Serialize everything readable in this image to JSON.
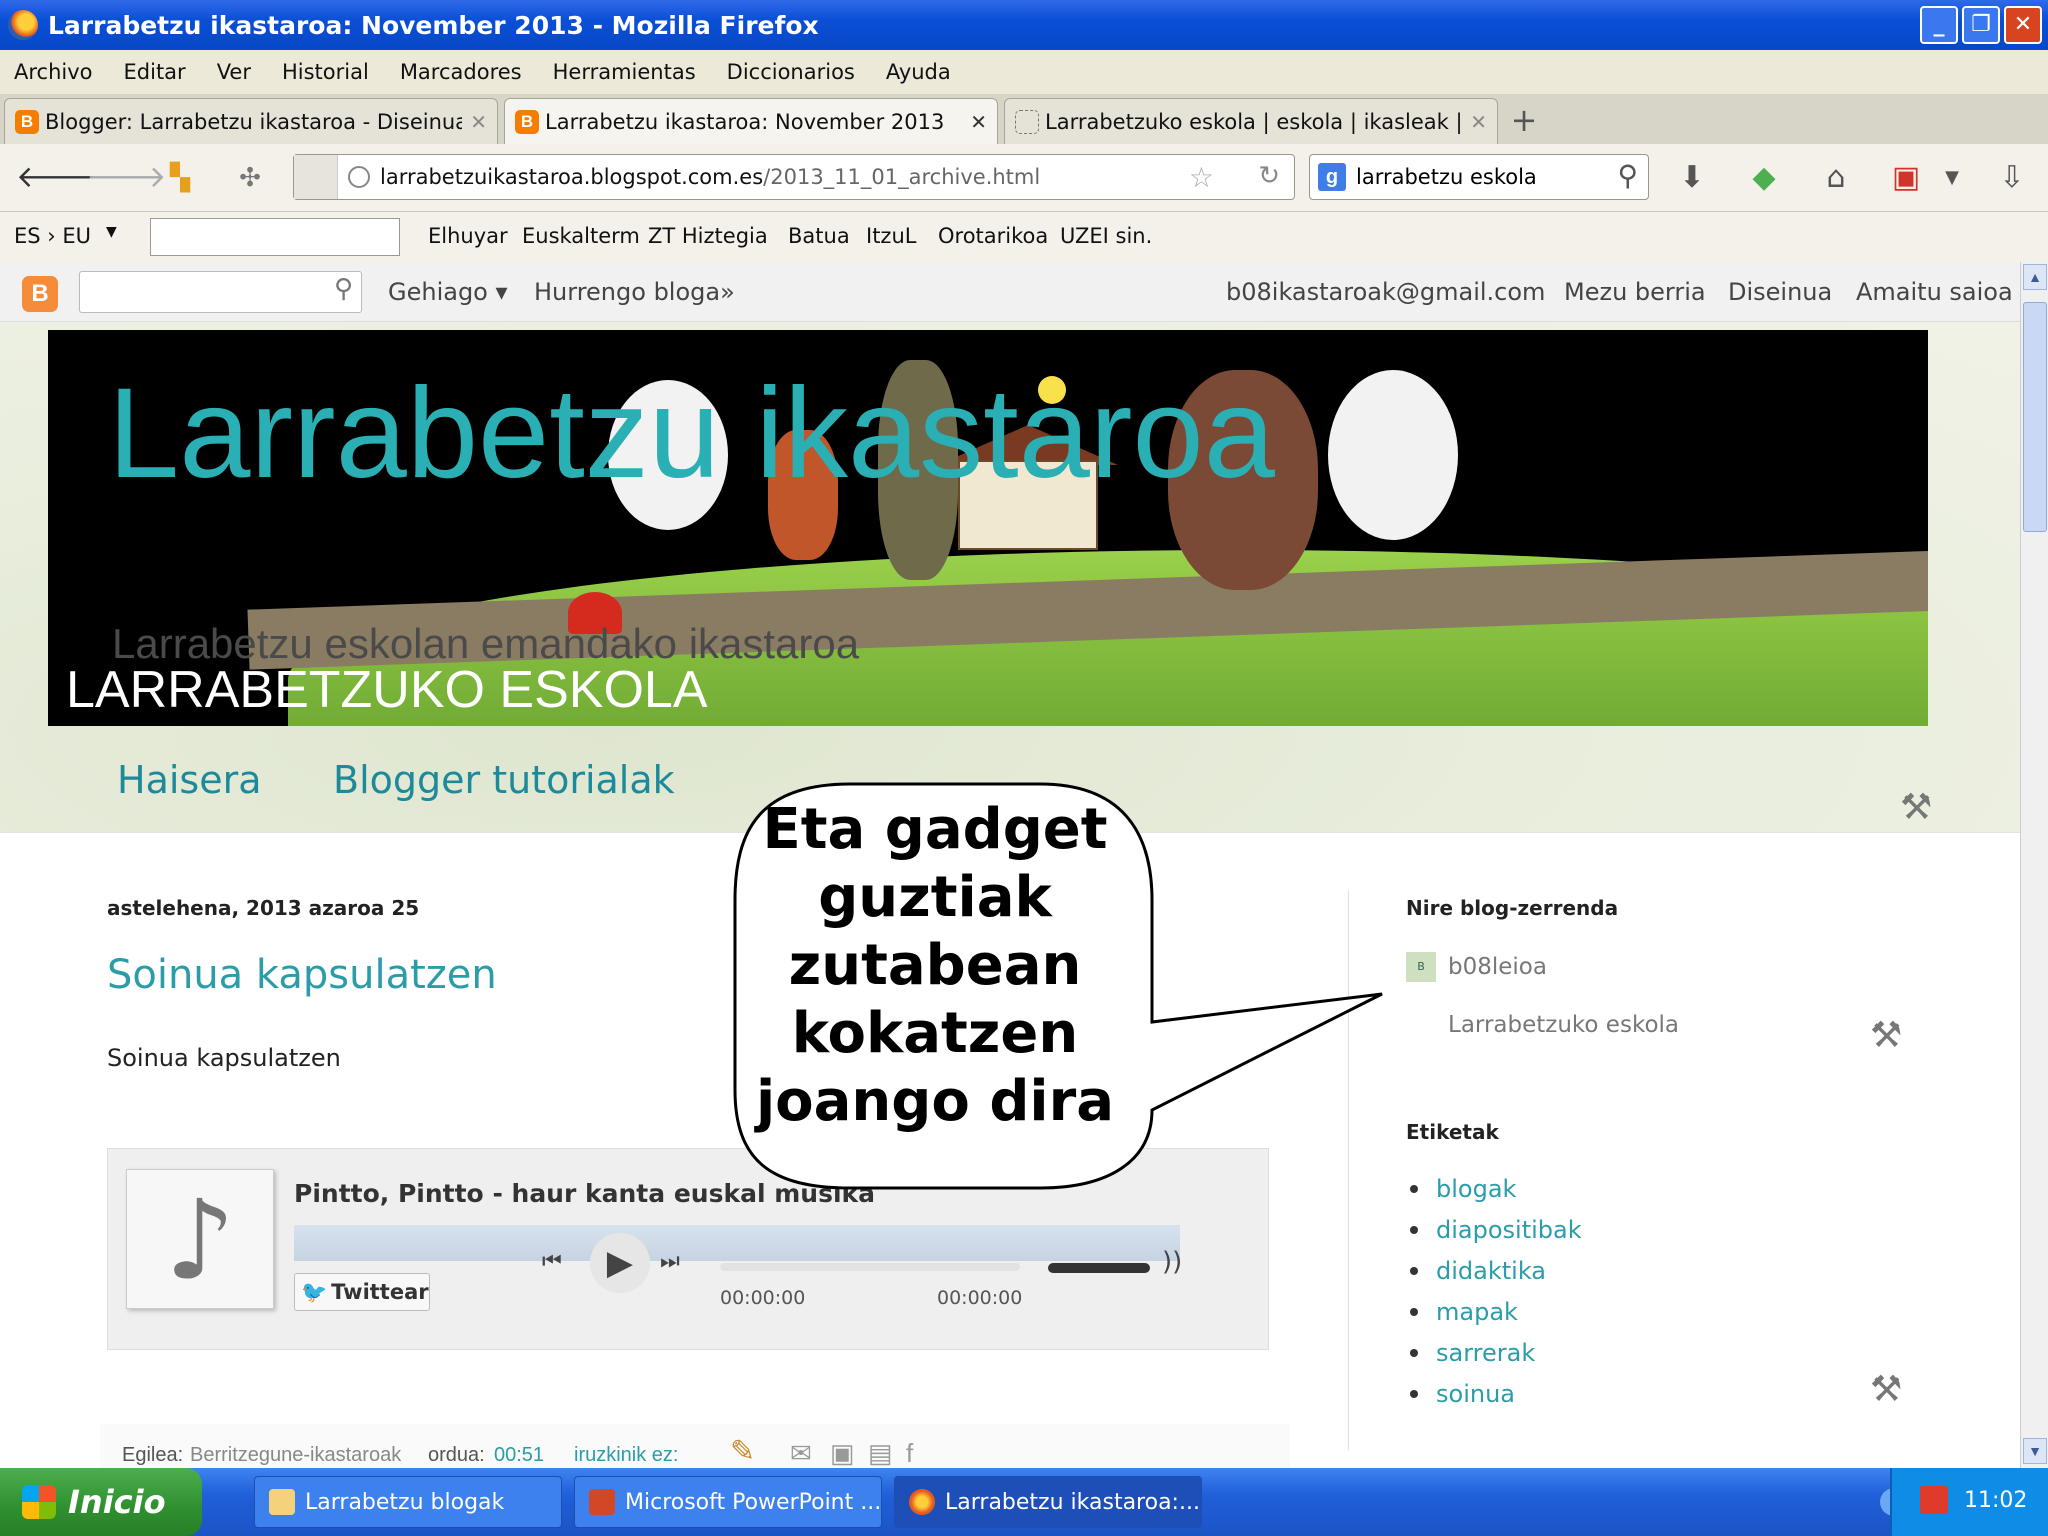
{
  "window": {
    "title": "Larrabetzu ikastaroa: November 2013 - Mozilla Firefox"
  },
  "menu": [
    "Archivo",
    "Editar",
    "Ver",
    "Historial",
    "Marcadores",
    "Herramientas",
    "Diccionarios",
    "Ayuda"
  ],
  "tabs": [
    {
      "label": "Blogger: Larrabetzu ikastaroa - Diseinua",
      "active": false
    },
    {
      "label": "Larrabetzu ikastaroa: November 2013",
      "active": true
    },
    {
      "label": "Larrabetzuko eskola | eskola | ikasleak | ...",
      "active": false
    }
  ],
  "url": {
    "host": "larrabetzuikastaroa.blogspot.com.es",
    "path": "/2013_11_01_archive.html"
  },
  "search": {
    "engine": "g",
    "value": "larrabetzu eskola"
  },
  "dict_toolbar": {
    "lang": "ES › EU",
    "links": [
      "Elhuyar",
      "Euskalterm",
      "ZT Hiztegia",
      "Batua",
      "ItzuL",
      "Orotarikoa",
      "UZEI sin."
    ]
  },
  "blogger_bar": {
    "more": "Gehiago ▾",
    "next_blog": "Hurrengo bloga»",
    "email": "b08ikastaroak@gmail.com",
    "new_post": "Mezu berria",
    "design": "Diseinua",
    "sign_out": "Amaitu saioa"
  },
  "header": {
    "title": "Larrabetzu ikastaroa",
    "description": "Larrabetzu eskolan emandako ikastaroa",
    "school": "LARRABETZUKO ESKOLA"
  },
  "page_tabs": [
    "Haisera",
    "Blogger tutorialak"
  ],
  "post": {
    "date": "astelehena, 2013 azaroa 25",
    "title": "Soinua kapsulatzen",
    "body": "Soinua kapsulatzen",
    "player": {
      "track": "Pintto, Pintto - haur kanta euskal musika",
      "twitter": "Twittear",
      "time_current": "00:00:00",
      "time_total": "00:00:00"
    },
    "footer": {
      "author_label": "Egilea:",
      "author": "Berritzegune-ikastaroak",
      "time_label": "ordua:",
      "time": "00:51",
      "comments": "iruzkinik ez:"
    }
  },
  "sidebar": {
    "bloglist_title": "Nire blog-zerrenda",
    "blog_name": "b08leioa",
    "blog_sub": "Larrabetzuko eskola",
    "labels_title": "Etiketak",
    "labels": [
      "blogak",
      "diapositibak",
      "didaktika",
      "mapak",
      "sarrerak",
      "soinua"
    ]
  },
  "callout": {
    "lines": [
      "Eta gadget",
      "guztiak",
      "zutabean",
      "kokatzen",
      "joango dira"
    ]
  },
  "taskbar": {
    "start": "Inicio",
    "tasks": [
      "Larrabetzu blogak",
      "Microsoft PowerPoint ...",
      "Larrabetzu ikastaroa:..."
    ],
    "clock": "11:02"
  }
}
